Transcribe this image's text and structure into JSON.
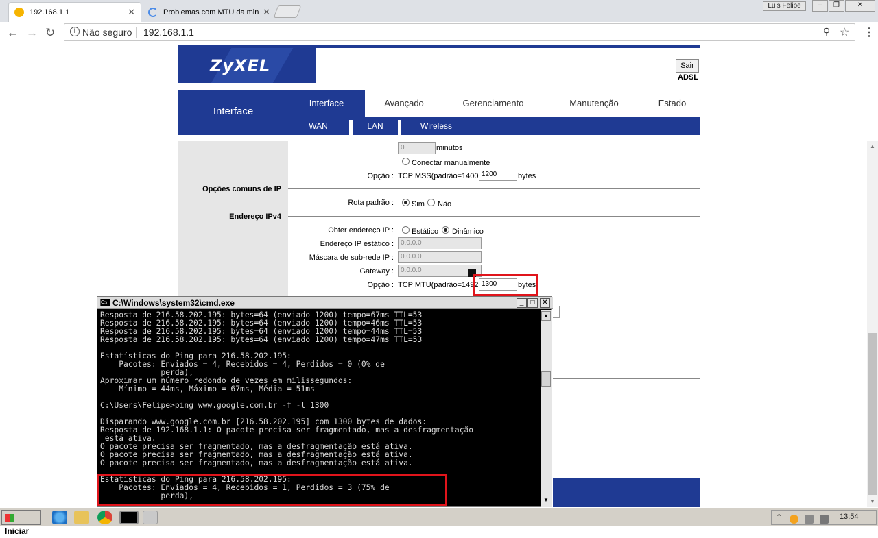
{
  "browser": {
    "tabs": [
      {
        "title": "192.168.1.1",
        "active": true
      },
      {
        "title": "Problemas com MTU da min",
        "active": false
      }
    ],
    "profile": "Luis Felipe",
    "security_label": "Não seguro",
    "url": "192.168.1.1",
    "colors": {
      "tab_active": "#ffffff",
      "chrome_bg": "#dee1e6"
    }
  },
  "router": {
    "logo": "ZyXEL",
    "logout_label": "Sair",
    "mode": "ADSL",
    "section_title": "Interface",
    "main_tabs": [
      "Interface",
      "Avançado",
      "Gerenciamento",
      "Manutenção",
      "Estado"
    ],
    "sub_tabs": [
      "WAN",
      "LAN",
      "Wireless"
    ],
    "brand_color": "#1f3a93",
    "timeout": {
      "value": "0",
      "unit": "minutos"
    },
    "connect_manual_label": "Conectar manualmente",
    "mss": {
      "label": "Opção :",
      "text": "TCP MSS(padrão=1400):",
      "value": "1200",
      "unit": "bytes"
    },
    "ip_common_label": "Opções comuns de IP",
    "default_route": {
      "label": "Rota padrão :",
      "options": [
        "Sim",
        "Não"
      ],
      "selected": "Sim"
    },
    "ipv4_label": "Endereço IPv4",
    "obtain_ip": {
      "label": "Obter endereço IP :",
      "options": [
        "Estático",
        "Dinâmico"
      ],
      "selected": "Dinâmico"
    },
    "static_ip": {
      "label": "Endereço IP estático :",
      "value": "0.0.0.0"
    },
    "subnet_mask": {
      "label": "Máscara de sub-rede IP :",
      "value": "0.0.0.0"
    },
    "gateway": {
      "label": "Gateway :",
      "value": "0.0.0.0"
    },
    "mtu": {
      "label": "Opção :",
      "text": "TCP MTU(padrão=1492):",
      "value": "1300",
      "unit": "bytes"
    }
  },
  "cmd": {
    "title": "C:\\Windows\\system32\\cmd.exe",
    "lines": [
      "Resposta de 216.58.202.195: bytes=64 (enviado 1200) tempo=67ms TTL=53",
      "Resposta de 216.58.202.195: bytes=64 (enviado 1200) tempo=46ms TTL=53",
      "Resposta de 216.58.202.195: bytes=64 (enviado 1200) tempo=44ms TTL=53",
      "Resposta de 216.58.202.195: bytes=64 (enviado 1200) tempo=47ms TTL=53",
      "",
      "Estatísticas do Ping para 216.58.202.195:",
      "    Pacotes: Enviados = 4, Recebidos = 4, Perdidos = 0 (0% de",
      "             perda),",
      "Aproximar um número redondo de vezes em milissegundos:",
      "    Mínimo = 44ms, Máximo = 67ms, Média = 51ms",
      "",
      "C:\\Users\\Felipe>ping www.google.com.br -f -l 1300",
      "",
      "Disparando www.google.com.br [216.58.202.195] com 1300 bytes de dados:",
      "Resposta de 192.168.1.1: O pacote precisa ser fragmentado, mas a desfragmentação",
      " está ativa.",
      "O pacote precisa ser fragmentado, mas a desfragmentação está ativa.",
      "O pacote precisa ser fragmentado, mas a desfragmentação está ativa.",
      "O pacote precisa ser fragmentado, mas a desfragmentação está ativa.",
      "",
      "Estatísticas do Ping para 216.58.202.195:",
      "    Pacotes: Enviados = 4, Recebidos = 1, Perdidos = 3 (75% de",
      "             perda),"
    ],
    "highlight_color": "#e0141b"
  },
  "taskbar": {
    "start_label": "Iniciar",
    "clock": "13:54"
  }
}
